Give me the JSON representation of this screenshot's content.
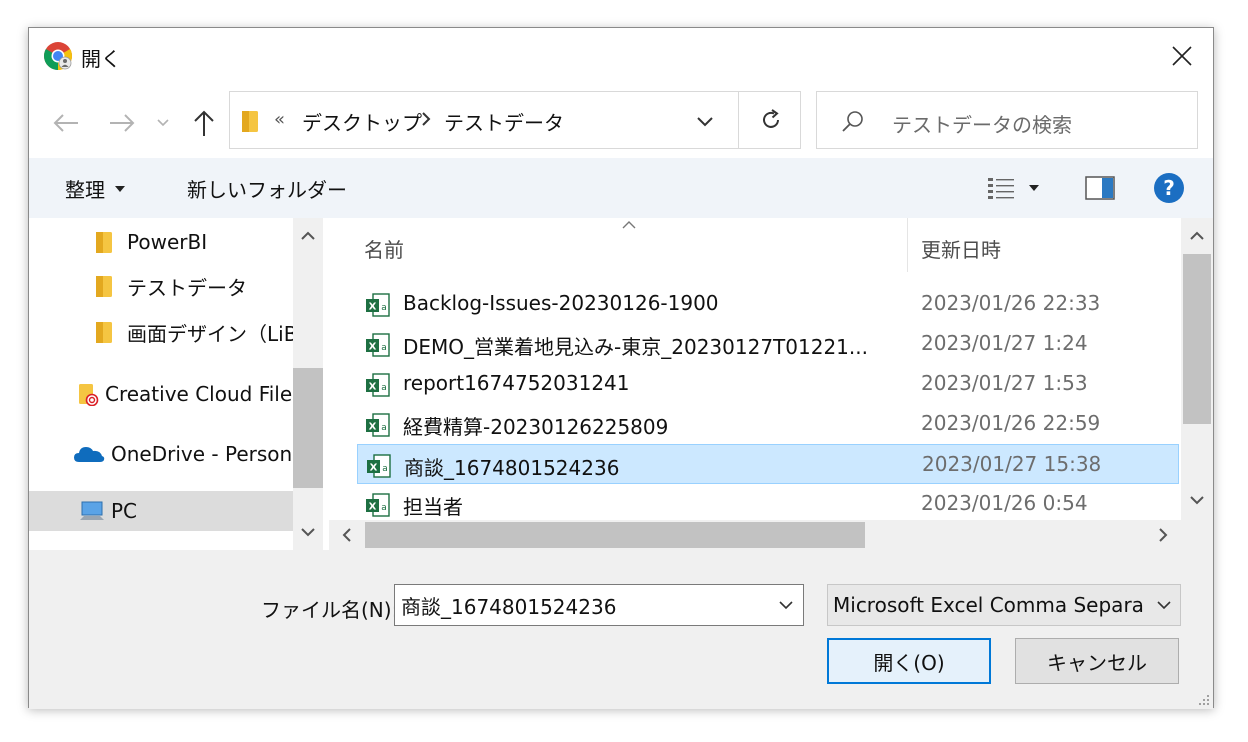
{
  "window": {
    "title": "開く"
  },
  "address": {
    "overflow": "«",
    "crumbs": [
      "デスクトップ",
      "テストデータ"
    ]
  },
  "search": {
    "placeholder": "テストデータの検索"
  },
  "toolbar": {
    "organize_label": "整理",
    "new_folder_label": "新しいフォルダー"
  },
  "nav": {
    "items": [
      {
        "label": "PowerBI",
        "icon": "folder-icon"
      },
      {
        "label": "テストデータ",
        "icon": "folder-icon"
      },
      {
        "label": "画面デザイン（LiB",
        "icon": "folder-icon"
      },
      {
        "label": "Creative Cloud File",
        "icon": "creative-cloud-icon"
      },
      {
        "label": "OneDrive - Person",
        "icon": "onedrive-icon"
      },
      {
        "label": "PC",
        "icon": "pc-icon"
      }
    ]
  },
  "list": {
    "columns": {
      "name": "名前",
      "date": "更新日時"
    },
    "rows": [
      {
        "name": "Backlog-Issues-20230126-1900",
        "date": "2023/01/26 22:33"
      },
      {
        "name": "DEMO_営業着地見込み-東京_20230127T01221...",
        "date": "2023/01/27 1:24"
      },
      {
        "name": "report1674752031241",
        "date": "2023/01/27 1:53"
      },
      {
        "name": "経費精算-20230126225809",
        "date": "2023/01/26 22:59"
      },
      {
        "name": "商談_1674801524236",
        "date": "2023/01/27 15:38"
      },
      {
        "name": "担当者",
        "date": "2023/01/26 0:54"
      }
    ]
  },
  "footer": {
    "filename_label": "ファイル名(N):",
    "filename_value": "商談_1674801524236",
    "filetype_value": "Microsoft Excel Comma Separat",
    "open_label": "開く(O)",
    "cancel_label": "キャンセル"
  },
  "colors": {
    "selected_row": "#cce8ff",
    "accent": "#0078d7",
    "excel_green": "#1d6f42",
    "folder_yellow": "#f5c542"
  }
}
